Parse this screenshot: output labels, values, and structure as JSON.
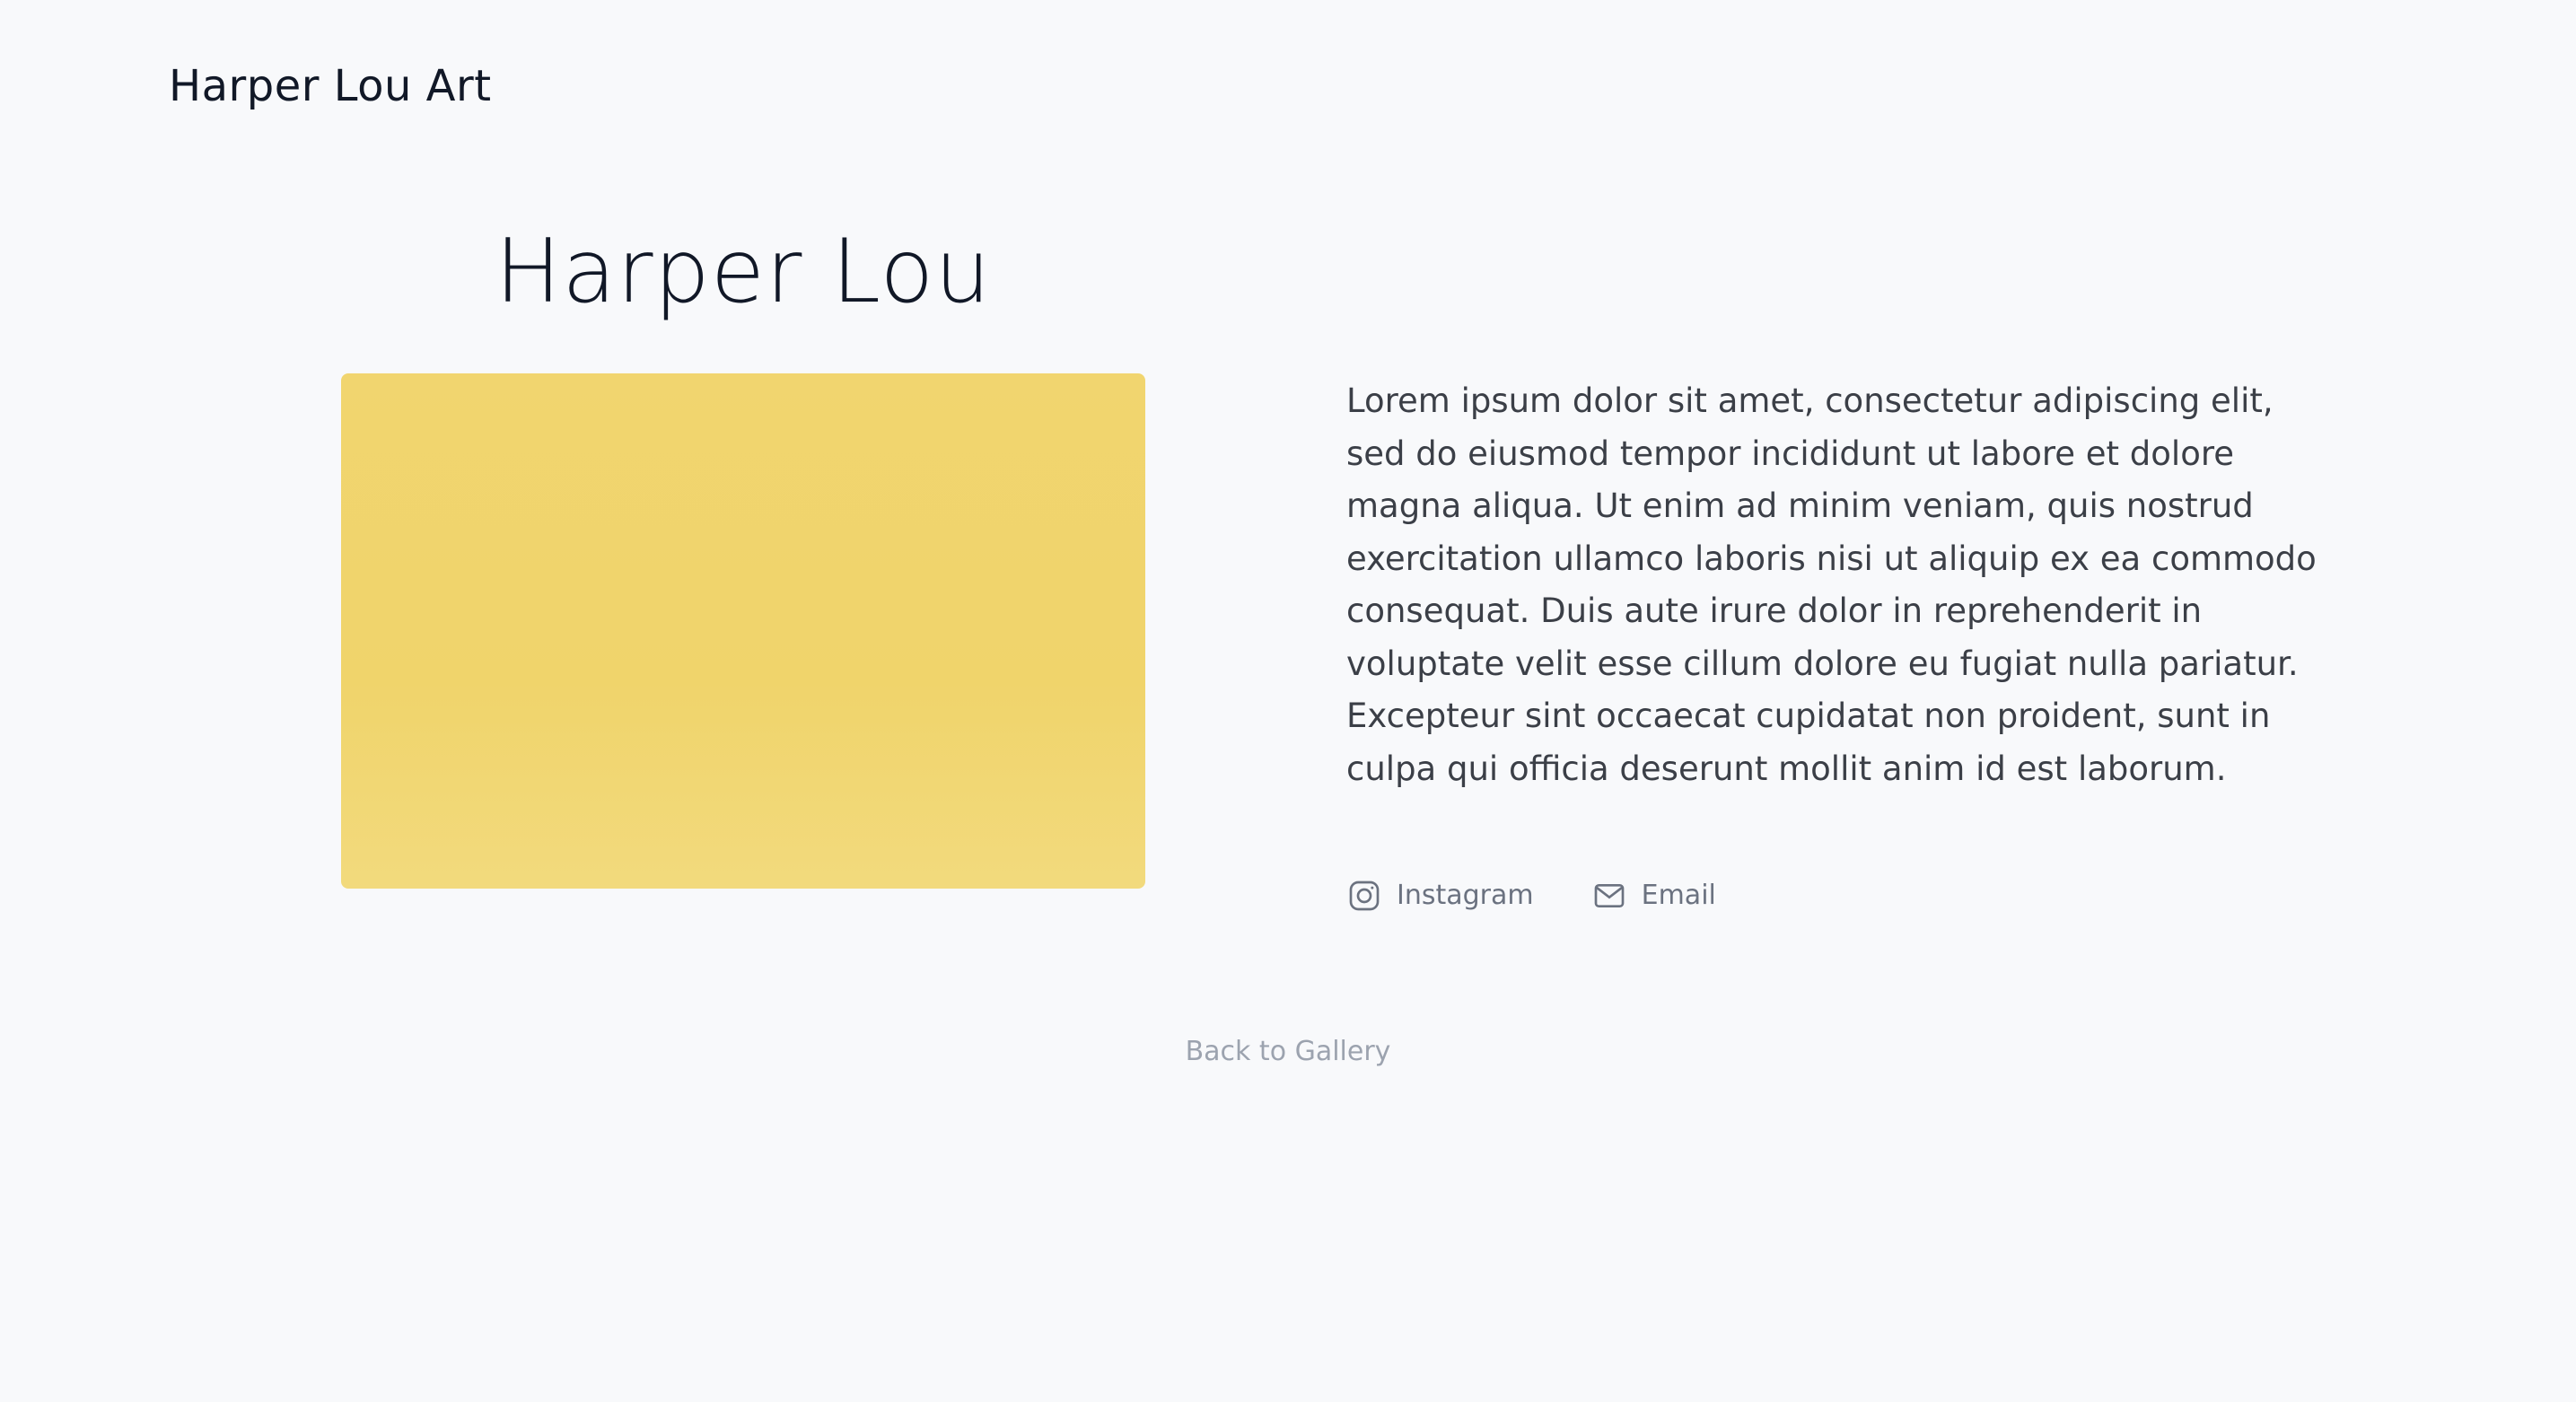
{
  "header": {
    "site_title": "Harper Lou Art"
  },
  "artist": {
    "name": "Harper Lou",
    "artwork_color": "#f1d56f",
    "bio": "Lorem ipsum dolor sit amet, consectetur adipiscing elit, sed do eiusmod tempor incididunt ut labore et dolore magna aliqua. Ut enim ad minim veniam, quis nostrud exercitation ullamco laboris nisi ut aliquip ex ea commodo consequat. Duis aute irure dolor in reprehenderit in voluptate velit esse cillum dolore eu fugiat nulla pariatur. Excepteur sint occaecat cupidatat non proident, sunt in culpa qui officia deserunt mollit anim id est laborum."
  },
  "social": {
    "instagram": {
      "label": "Instagram",
      "icon": "instagram-icon"
    },
    "email": {
      "label": "Email",
      "icon": "mail-icon"
    }
  },
  "navigation": {
    "back_label": "Back to Gallery"
  },
  "colors": {
    "background": "#f8f9fb",
    "text_primary": "#111827",
    "text_body": "#3b3f47",
    "text_muted": "#6b7280",
    "text_subtle": "#9ca3af"
  }
}
